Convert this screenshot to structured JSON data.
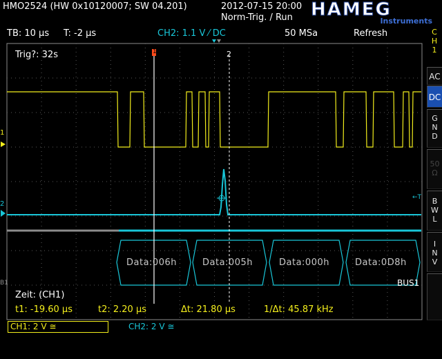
{
  "header": {
    "device": "HMO2524 (HW 0x10120007; SW 04.201)",
    "datetime": "2012-07-15 20:00",
    "trigger_mode": "Norm-Trig. / Run"
  },
  "logo": {
    "brand": "HAMEG",
    "subtitle": "Instruments"
  },
  "statusbar": {
    "timebase": "TB: 10 µs",
    "trigger_time": "T: -2 µs",
    "channel_setting": "CH2: 1.1 V ⁄ DC",
    "sample_rate": "50 MSa",
    "acq_mode": "Refresh"
  },
  "screen": {
    "trig_info": "Trig?: 32s",
    "cursor1_label": "1",
    "cursor2_label": "2",
    "ch1_marker": "1",
    "ch2_marker": "2",
    "bus_marker": "B1",
    "trig_marker": "←T",
    "bus_name": "BUS1",
    "bus_frames": [
      "Data:006h",
      "Data:005h",
      "Data:000h",
      "Data:0D8h"
    ]
  },
  "measurements": {
    "title": "Zeit: (CH1)",
    "t1": "t1: -19.60 µs",
    "t2": "t2: 2.20 µs",
    "dt": "Δt: 21.80 µs",
    "freq": "1/Δt: 45.87 kHz"
  },
  "side_panel": {
    "channel": [
      "C",
      "H",
      "1"
    ],
    "ac": "AC",
    "dc": "DC",
    "gnd": [
      "G",
      "N",
      "D"
    ],
    "fifty": [
      "50",
      "Ω"
    ],
    "bwl": [
      "B",
      "W",
      "L"
    ],
    "inv": [
      "I",
      "N",
      "V"
    ]
  },
  "bottom": {
    "ch1": "CH1: 2 V ≅",
    "ch2": "CH2: 2 V ≅"
  },
  "colors": {
    "ch1": "#f4ef1c",
    "ch2": "#19c6d8",
    "active_button": "#1a4fb0",
    "cursor1": "#ff4a1a"
  }
}
